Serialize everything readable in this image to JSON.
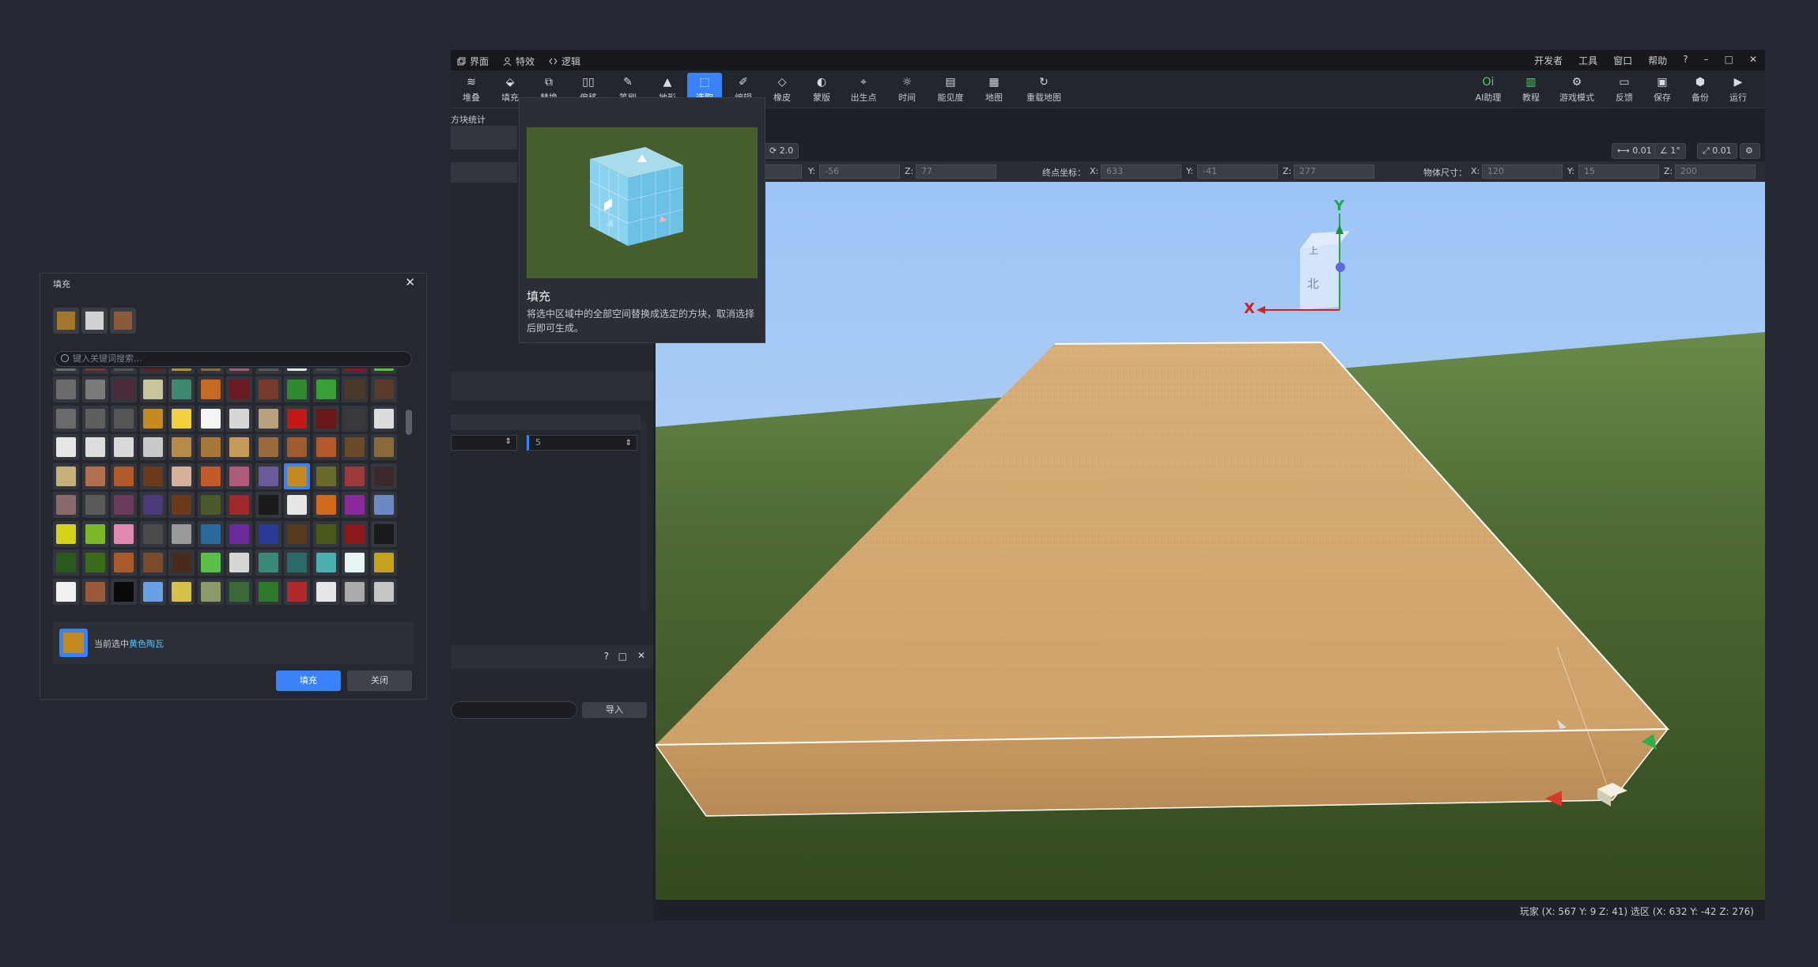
{
  "menubar": {
    "left": [
      {
        "label": "界面",
        "icon": "window-icon"
      },
      {
        "label": "特效",
        "icon": "person-icon"
      },
      {
        "label": "逻辑",
        "icon": "code-icon"
      }
    ],
    "right": [
      "开发者",
      "工具",
      "窗口",
      "帮助"
    ]
  },
  "toolbar": {
    "left": [
      {
        "label": "堆叠",
        "icon": "layers-icon"
      },
      {
        "label": "填充",
        "icon": "bucket-icon"
      },
      {
        "label": "替换",
        "icon": "swap-icon"
      },
      {
        "label": "偏移",
        "icon": "columns-icon"
      },
      {
        "label": "笔刷",
        "icon": "brush-icon"
      },
      {
        "label": "地形",
        "icon": "mountain-icon"
      },
      {
        "label": "选取",
        "icon": "select-icon"
      },
      {
        "label": "编辑",
        "icon": "pen-icon"
      },
      {
        "label": "橡皮",
        "icon": "eraser-icon"
      },
      {
        "label": "蒙版",
        "icon": "mask-icon"
      },
      {
        "label": "出生点",
        "icon": "pin-icon"
      },
      {
        "label": "时间",
        "icon": "time-icon"
      },
      {
        "label": "能见度",
        "icon": "visibility-icon"
      },
      {
        "label": "地图",
        "icon": "map-icon"
      },
      {
        "label": "重载地图",
        "icon": "reload-icon"
      }
    ],
    "active_index": 6,
    "right": [
      {
        "label": "AI助理",
        "icon": "ai-icon"
      },
      {
        "label": "教程",
        "icon": "book-icon"
      },
      {
        "label": "游戏模式",
        "icon": "gamepad-icon"
      },
      {
        "label": "反馈",
        "icon": "feedback-icon"
      },
      {
        "label": "保存",
        "icon": "save-icon"
      },
      {
        "label": "备份",
        "icon": "backup-icon"
      },
      {
        "label": "运行",
        "icon": "play-icon"
      }
    ]
  },
  "leftpanel": {
    "tab": "方块统计"
  },
  "tooltip": {
    "title": "填充",
    "desc": "将选中区域中的全部空间替换成选定的方块，取消选择后即可生成。"
  },
  "snap": {
    "scale": "2.0",
    "move": "0.01",
    "angle": "1°",
    "size": "0.01"
  },
  "coords": {
    "y1": "-56",
    "z1": "77",
    "end_label": "终点坐标：",
    "end": {
      "x": "633",
      "y": "-41",
      "z": "277"
    },
    "size_label": "物体尺寸：",
    "size": {
      "x": "120",
      "y": "15",
      "z": "200"
    }
  },
  "mid": {
    "field1": "",
    "field2": "5",
    "import": "导入"
  },
  "gizmo": {
    "top": "上",
    "north": "北",
    "x": "X",
    "y": "Y"
  },
  "status": "玩家 (X: 567  Y: 9  Z: 41)  选区 (X: 632  Y: -42  Z: 276)",
  "fill_dialog": {
    "title": "填充",
    "search_placeholder": "键入关键词搜索...",
    "current_prefix": "当前选中",
    "current_block": "黄色陶瓦",
    "fill_btn": "填充",
    "close_btn": "关闭"
  },
  "colors": {
    "accent": "#3a82f7",
    "selected_block": "#c58a1f"
  }
}
